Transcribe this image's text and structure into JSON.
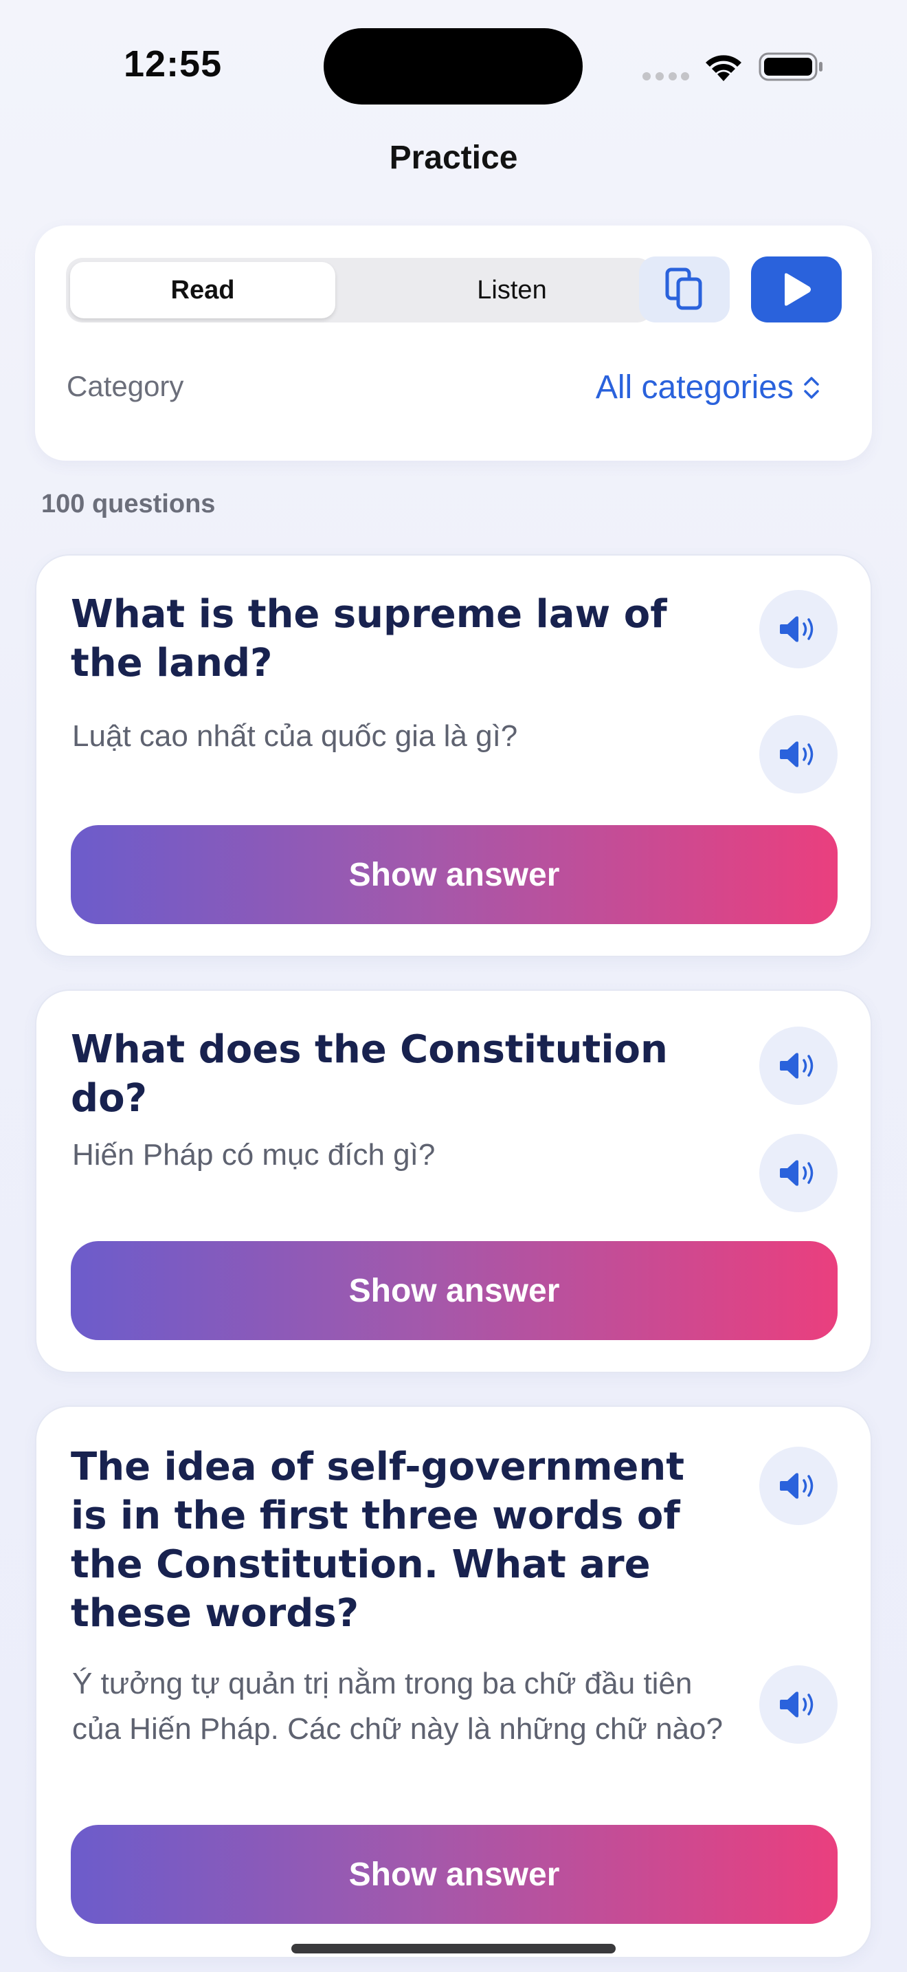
{
  "status_bar": {
    "time": "12:55"
  },
  "nav": {
    "title": "Practice"
  },
  "controls": {
    "mode_tabs": [
      {
        "label": "Read",
        "selected": true
      },
      {
        "label": "Listen",
        "selected": false
      }
    ],
    "copy_icon": "copy-icon",
    "play_icon": "play-icon",
    "category_label": "Category",
    "category_value": "All categories",
    "accent_color": "#2a62dc"
  },
  "question_count": "100 questions",
  "questions": [
    {
      "question": "What is the supreme law of the land?",
      "translation": "Luật cao nhất của quốc gia là gì?",
      "answer_label": "Show answer"
    },
    {
      "question": "What does the Constitution do?",
      "translation": "Hiến Pháp có mục đích gì?",
      "answer_label": "Show answer"
    },
    {
      "question": "The idea of self-government is in the first three words of the Constitution. What are these words?",
      "translation": "Ý tưởng tự quản trị nằm trong ba chữ đầu tiên của Hiến Pháp. Các chữ này là những chữ nào?",
      "answer_label": "Show answer"
    }
  ]
}
